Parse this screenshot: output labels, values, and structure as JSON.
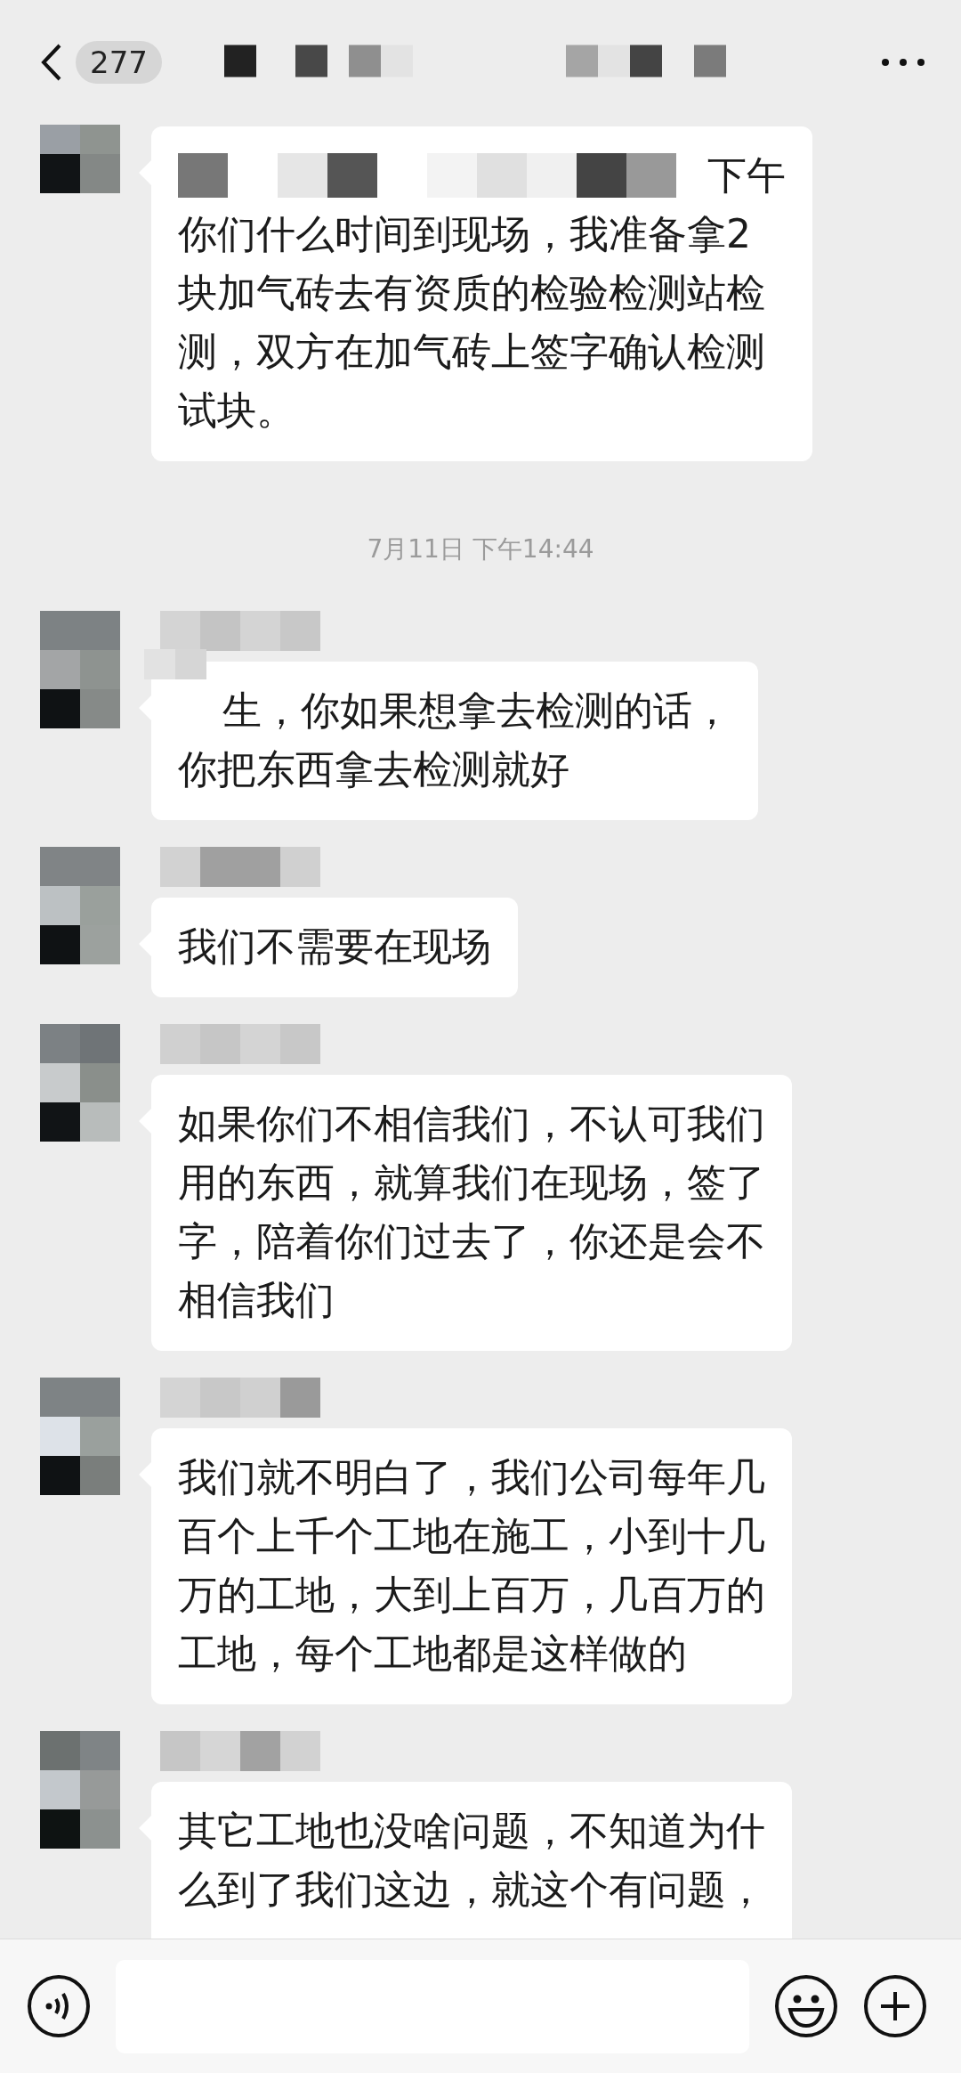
{
  "header": {
    "unread_count": "277"
  },
  "messages": [
    {
      "kind": "message",
      "masked_start": true,
      "lead": "下午",
      "lines": [
        "你们什么时间到现场，我准备拿2",
        "块加气砖去有资质的检验检测站检",
        "测，双方在加气砖上签字确认检测",
        "试块。"
      ]
    },
    {
      "kind": "timestamp",
      "text": "7月11日 下午14:44"
    },
    {
      "kind": "message",
      "masked_start": true,
      "lines": [
        "生，你如果想拿去检测的话，",
        "你把东西拿去检测就好"
      ]
    },
    {
      "kind": "message",
      "masked_start": false,
      "lines": [
        "我们不需要在现场"
      ]
    },
    {
      "kind": "message",
      "masked_start": false,
      "lines": [
        "如果你们不相信我们，不认可我们",
        "用的东西，就算我们在现场，签了",
        "字，陪着你们过去了，你还是会不",
        "相信我们"
      ]
    },
    {
      "kind": "message",
      "masked_start": false,
      "lines": [
        "我们就不明白了，我们公司每年几",
        "百个上千个工地在施工，小到十几",
        "万的工地，大到上百万，几百万的",
        "工地，每个工地都是这样做的"
      ]
    },
    {
      "kind": "message",
      "masked_start": false,
      "lines": [
        "其它工地也没啥问题，不知道为什",
        "么到了我们这边，就这个有问题，"
      ]
    }
  ]
}
